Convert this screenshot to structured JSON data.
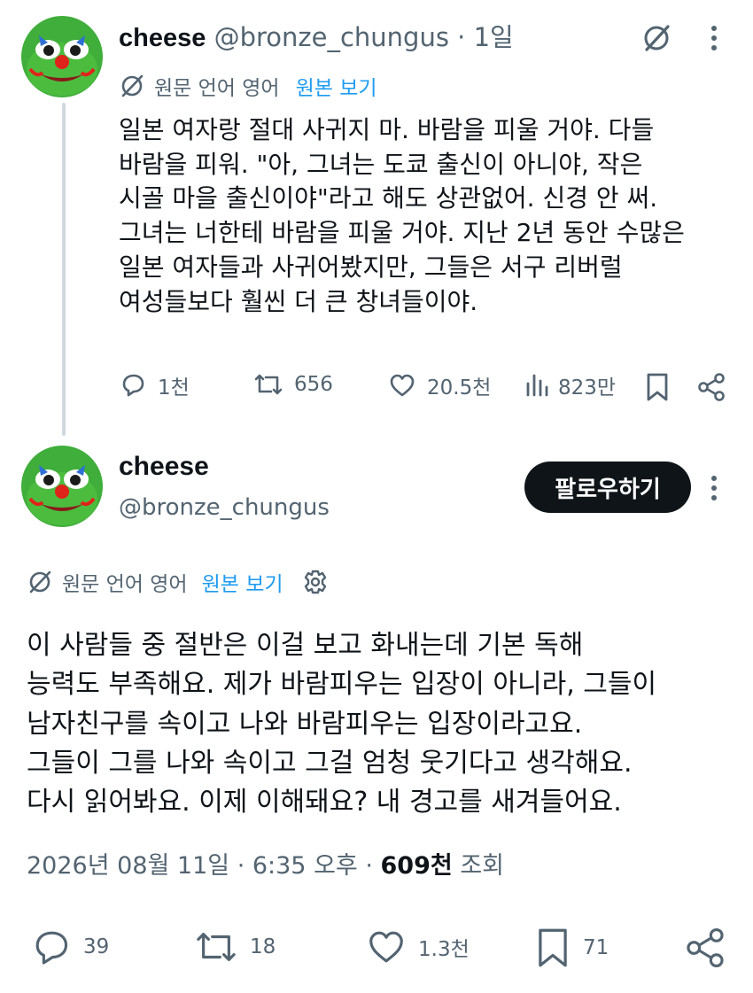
{
  "tweet1": {
    "display_name": "cheese",
    "handle": "@bronze_chungus",
    "age": "· 1일",
    "translation": {
      "label": "원문 언어 영어",
      "link": "원본 보기"
    },
    "lines": [
      "일본 여자랑 절대 사귀지 마. 바람을 피울 거야. 다들",
      "바람을 피워. \"아, 그녀는 도쿄 출신이 아니야, 작은",
      "시골 마을 출신이야\"라고 해도 상관없어. 신경 안 써.",
      "그녀는 너한테 바람을 피울 거야. 지난 2년 동안 수많은",
      "일본 여자들과 사귀어봤지만, 그들은 서구 리버럴",
      "여성들보다 훨씬 더 큰 창녀들이야."
    ],
    "stats": {
      "replies": "1천",
      "reposts": "656",
      "likes": "20.5천",
      "views": "823만"
    }
  },
  "tweet2": {
    "display_name": "cheese",
    "handle": "@bronze_chungus",
    "follow_label": "팔로우하기",
    "translation": {
      "label": "원문 언어 영어",
      "link": "원본 보기"
    },
    "lines": [
      "이 사람들 중 절반은 이걸 보고 화내는데 기본 독해",
      "능력도 부족해요. 제가 바람피우는 입장이 아니라, 그들이",
      "남자친구를 속이고 나와 바람피우는 입장이라고요.",
      "그들이 그를 나와 속이고 그걸 엄청 웃기다고 생각해요.",
      "다시 읽어봐요. 이제 이해돼요? 내 경고를 새겨들어요."
    ],
    "timestamp": "2026년 08월 11일 · 6:35 오후 ·",
    "views_count": "609천",
    "views_label": "조회",
    "stats": {
      "replies": "39",
      "reposts": "18",
      "likes": "1.3천",
      "bookmarks": "71"
    }
  },
  "colors": {
    "text": "#0f1419",
    "secondary": "#536471",
    "link": "#1d9bf0",
    "line": "#cfd9de"
  },
  "icons": [
    "grok-icon",
    "more-icon",
    "translate-icon",
    "settings-icon",
    "reply-icon",
    "repost-icon",
    "like-icon",
    "views-icon",
    "bookmark-icon",
    "share-icon",
    "avatar"
  ]
}
